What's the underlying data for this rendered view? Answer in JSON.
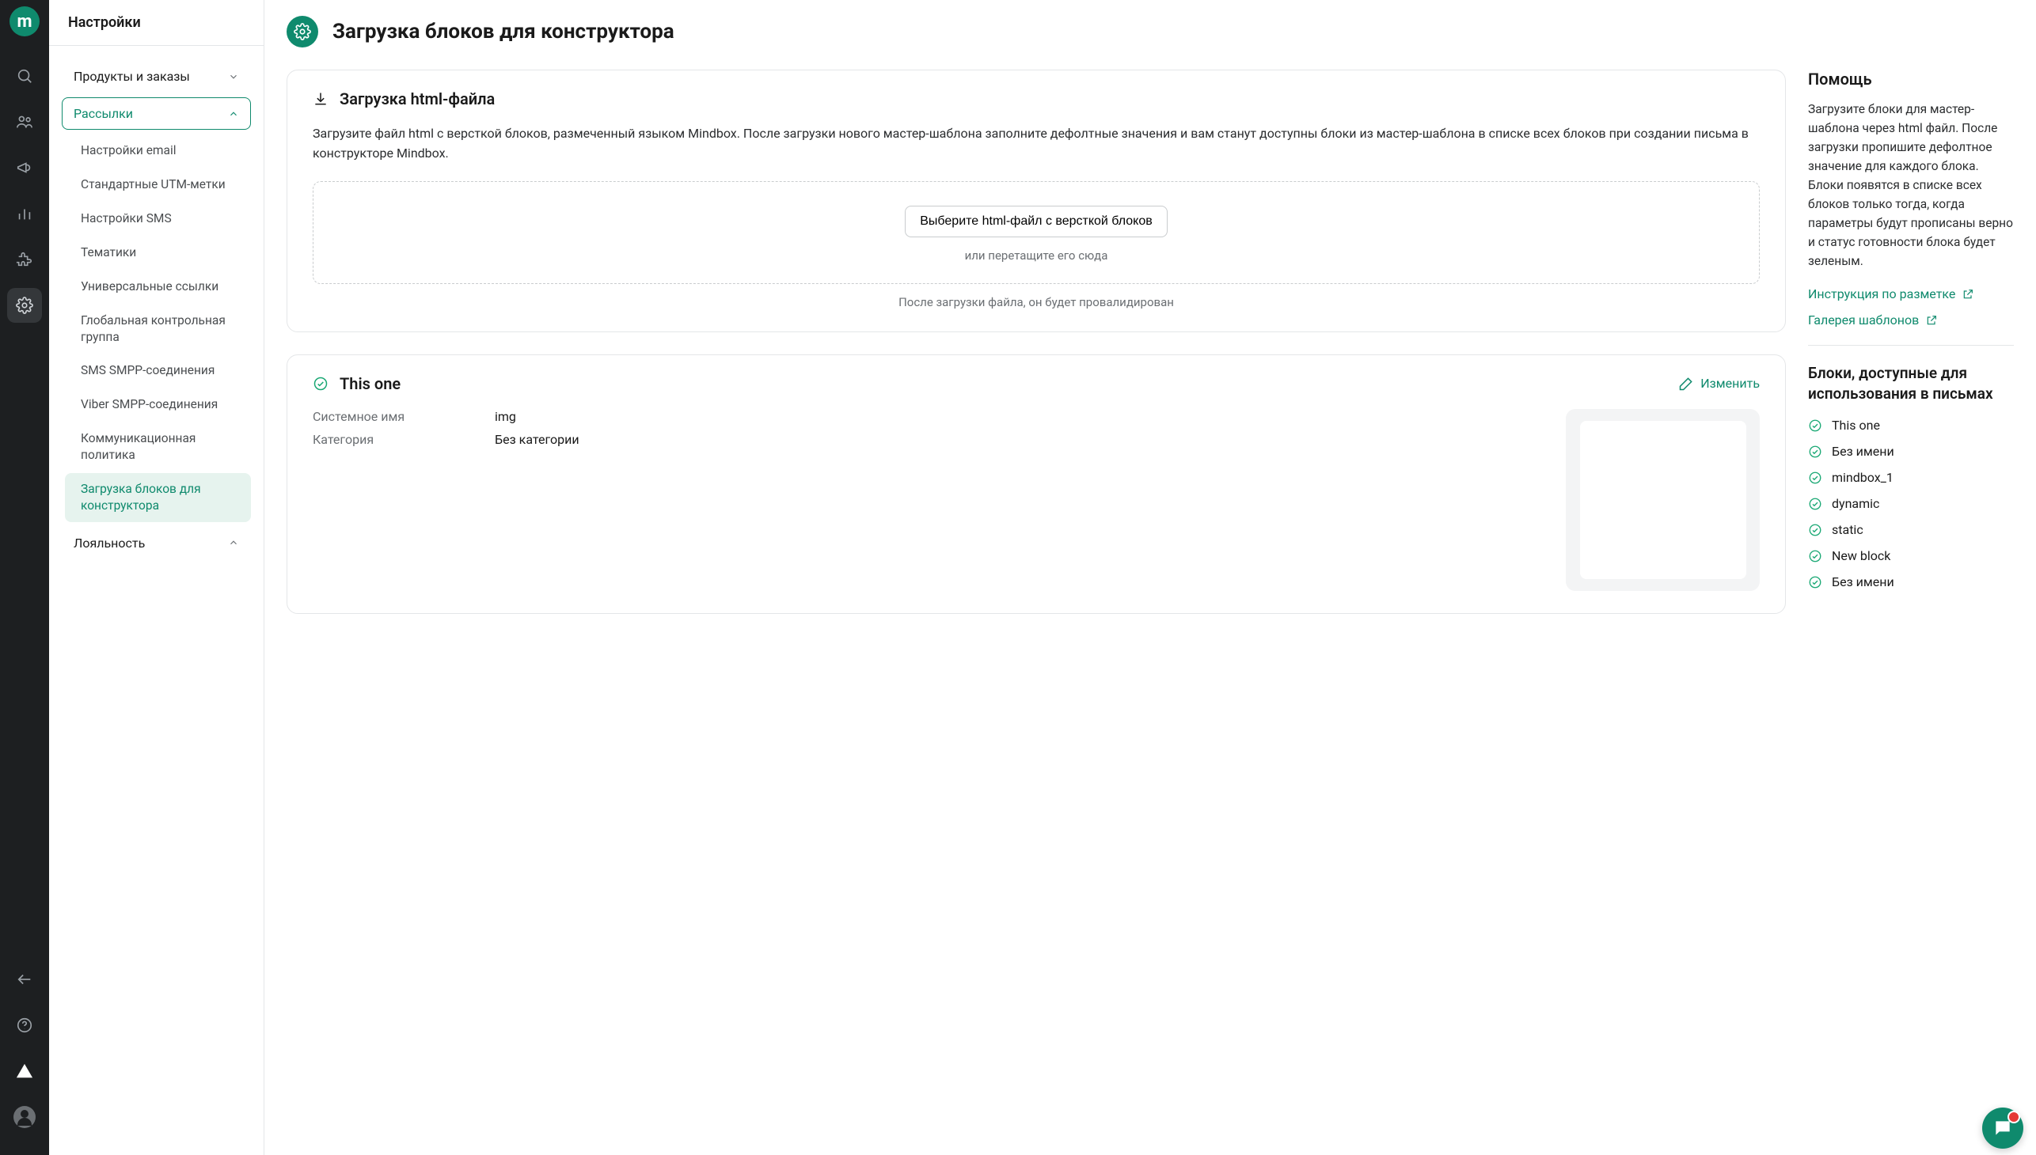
{
  "app": {
    "logo_letter": "m"
  },
  "sidebar": {
    "title": "Настройки",
    "groups": [
      {
        "label": "Продукты и заказы",
        "expanded": false
      },
      {
        "label": "Рассылки",
        "expanded": true,
        "items": [
          "Настройки email",
          "Стандартные UTM-метки",
          "Настройки SMS",
          "Тематики",
          "Универсальные ссылки",
          "Глобальная контрольная группа",
          "SMS SMPP-соединения",
          "Viber SMPP-соединения",
          "Коммуникационная политика",
          "Загрузка блоков для конструктора"
        ],
        "active_index": 9
      },
      {
        "label": "Лояльность",
        "expanded": false
      }
    ]
  },
  "page": {
    "title": "Загрузка блоков для конструктора"
  },
  "upload": {
    "heading": "Загрузка html-файла",
    "description": "Загрузите файл html с версткой блоков, размеченный языком Mindbox. После загрузки нового мастер-шаблона заполните дефолтные значения и вам станут доступны блоки из мастер-шаблона в списке всех блоков при создании письма в конструкторе Mindbox.",
    "button": "Выберите html-файл с версткой блоков",
    "or_hint": "или перетащите его сюда",
    "after_note": "После загрузки файла, он будет провалидирован"
  },
  "block_card": {
    "name": "This one",
    "edit_label": "Изменить",
    "rows": [
      {
        "key": "Системное имя",
        "val": "img"
      },
      {
        "key": "Категория",
        "val": "Без категории"
      }
    ]
  },
  "help": {
    "title": "Помощь",
    "text": "Загрузите блоки для мастер-шаблона через html файл. После загрузки пропишите дефолтное значение для каждого блока. Блоки появятся в списке всех блоков только тогда, когда параметры будут прописаны верно и статус готовности блока будет зеленым.",
    "links": [
      "Инструкция по разметке",
      "Галерея шаблонов"
    ]
  },
  "available": {
    "title": "Блоки, доступные для использования в письмах",
    "items": [
      "This one",
      "Без имени",
      "mindbox_1",
      "dynamic",
      "static",
      "New block",
      "Без имени"
    ]
  }
}
